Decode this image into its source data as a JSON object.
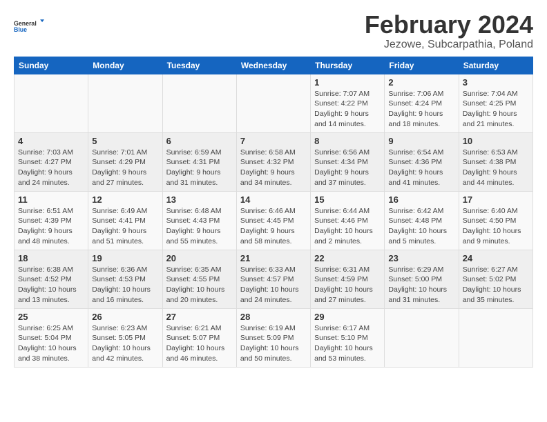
{
  "logo": {
    "general": "General",
    "blue": "Blue"
  },
  "header": {
    "title": "February 2024",
    "subtitle": "Jezowe, Subcarpathia, Poland"
  },
  "columns": [
    "Sunday",
    "Monday",
    "Tuesday",
    "Wednesday",
    "Thursday",
    "Friday",
    "Saturday"
  ],
  "weeks": [
    {
      "days": [
        {
          "num": "",
          "info": ""
        },
        {
          "num": "",
          "info": ""
        },
        {
          "num": "",
          "info": ""
        },
        {
          "num": "",
          "info": ""
        },
        {
          "num": "1",
          "info": "Sunrise: 7:07 AM\nSunset: 4:22 PM\nDaylight: 9 hours\nand 14 minutes."
        },
        {
          "num": "2",
          "info": "Sunrise: 7:06 AM\nSunset: 4:24 PM\nDaylight: 9 hours\nand 18 minutes."
        },
        {
          "num": "3",
          "info": "Sunrise: 7:04 AM\nSunset: 4:25 PM\nDaylight: 9 hours\nand 21 minutes."
        }
      ]
    },
    {
      "days": [
        {
          "num": "4",
          "info": "Sunrise: 7:03 AM\nSunset: 4:27 PM\nDaylight: 9 hours\nand 24 minutes."
        },
        {
          "num": "5",
          "info": "Sunrise: 7:01 AM\nSunset: 4:29 PM\nDaylight: 9 hours\nand 27 minutes."
        },
        {
          "num": "6",
          "info": "Sunrise: 6:59 AM\nSunset: 4:31 PM\nDaylight: 9 hours\nand 31 minutes."
        },
        {
          "num": "7",
          "info": "Sunrise: 6:58 AM\nSunset: 4:32 PM\nDaylight: 9 hours\nand 34 minutes."
        },
        {
          "num": "8",
          "info": "Sunrise: 6:56 AM\nSunset: 4:34 PM\nDaylight: 9 hours\nand 37 minutes."
        },
        {
          "num": "9",
          "info": "Sunrise: 6:54 AM\nSunset: 4:36 PM\nDaylight: 9 hours\nand 41 minutes."
        },
        {
          "num": "10",
          "info": "Sunrise: 6:53 AM\nSunset: 4:38 PM\nDaylight: 9 hours\nand 44 minutes."
        }
      ]
    },
    {
      "days": [
        {
          "num": "11",
          "info": "Sunrise: 6:51 AM\nSunset: 4:39 PM\nDaylight: 9 hours\nand 48 minutes."
        },
        {
          "num": "12",
          "info": "Sunrise: 6:49 AM\nSunset: 4:41 PM\nDaylight: 9 hours\nand 51 minutes."
        },
        {
          "num": "13",
          "info": "Sunrise: 6:48 AM\nSunset: 4:43 PM\nDaylight: 9 hours\nand 55 minutes."
        },
        {
          "num": "14",
          "info": "Sunrise: 6:46 AM\nSunset: 4:45 PM\nDaylight: 9 hours\nand 58 minutes."
        },
        {
          "num": "15",
          "info": "Sunrise: 6:44 AM\nSunset: 4:46 PM\nDaylight: 10 hours\nand 2 minutes."
        },
        {
          "num": "16",
          "info": "Sunrise: 6:42 AM\nSunset: 4:48 PM\nDaylight: 10 hours\nand 5 minutes."
        },
        {
          "num": "17",
          "info": "Sunrise: 6:40 AM\nSunset: 4:50 PM\nDaylight: 10 hours\nand 9 minutes."
        }
      ]
    },
    {
      "days": [
        {
          "num": "18",
          "info": "Sunrise: 6:38 AM\nSunset: 4:52 PM\nDaylight: 10 hours\nand 13 minutes."
        },
        {
          "num": "19",
          "info": "Sunrise: 6:36 AM\nSunset: 4:53 PM\nDaylight: 10 hours\nand 16 minutes."
        },
        {
          "num": "20",
          "info": "Sunrise: 6:35 AM\nSunset: 4:55 PM\nDaylight: 10 hours\nand 20 minutes."
        },
        {
          "num": "21",
          "info": "Sunrise: 6:33 AM\nSunset: 4:57 PM\nDaylight: 10 hours\nand 24 minutes."
        },
        {
          "num": "22",
          "info": "Sunrise: 6:31 AM\nSunset: 4:59 PM\nDaylight: 10 hours\nand 27 minutes."
        },
        {
          "num": "23",
          "info": "Sunrise: 6:29 AM\nSunset: 5:00 PM\nDaylight: 10 hours\nand 31 minutes."
        },
        {
          "num": "24",
          "info": "Sunrise: 6:27 AM\nSunset: 5:02 PM\nDaylight: 10 hours\nand 35 minutes."
        }
      ]
    },
    {
      "days": [
        {
          "num": "25",
          "info": "Sunrise: 6:25 AM\nSunset: 5:04 PM\nDaylight: 10 hours\nand 38 minutes."
        },
        {
          "num": "26",
          "info": "Sunrise: 6:23 AM\nSunset: 5:05 PM\nDaylight: 10 hours\nand 42 minutes."
        },
        {
          "num": "27",
          "info": "Sunrise: 6:21 AM\nSunset: 5:07 PM\nDaylight: 10 hours\nand 46 minutes."
        },
        {
          "num": "28",
          "info": "Sunrise: 6:19 AM\nSunset: 5:09 PM\nDaylight: 10 hours\nand 50 minutes."
        },
        {
          "num": "29",
          "info": "Sunrise: 6:17 AM\nSunset: 5:10 PM\nDaylight: 10 hours\nand 53 minutes."
        },
        {
          "num": "",
          "info": ""
        },
        {
          "num": "",
          "info": ""
        }
      ]
    }
  ]
}
